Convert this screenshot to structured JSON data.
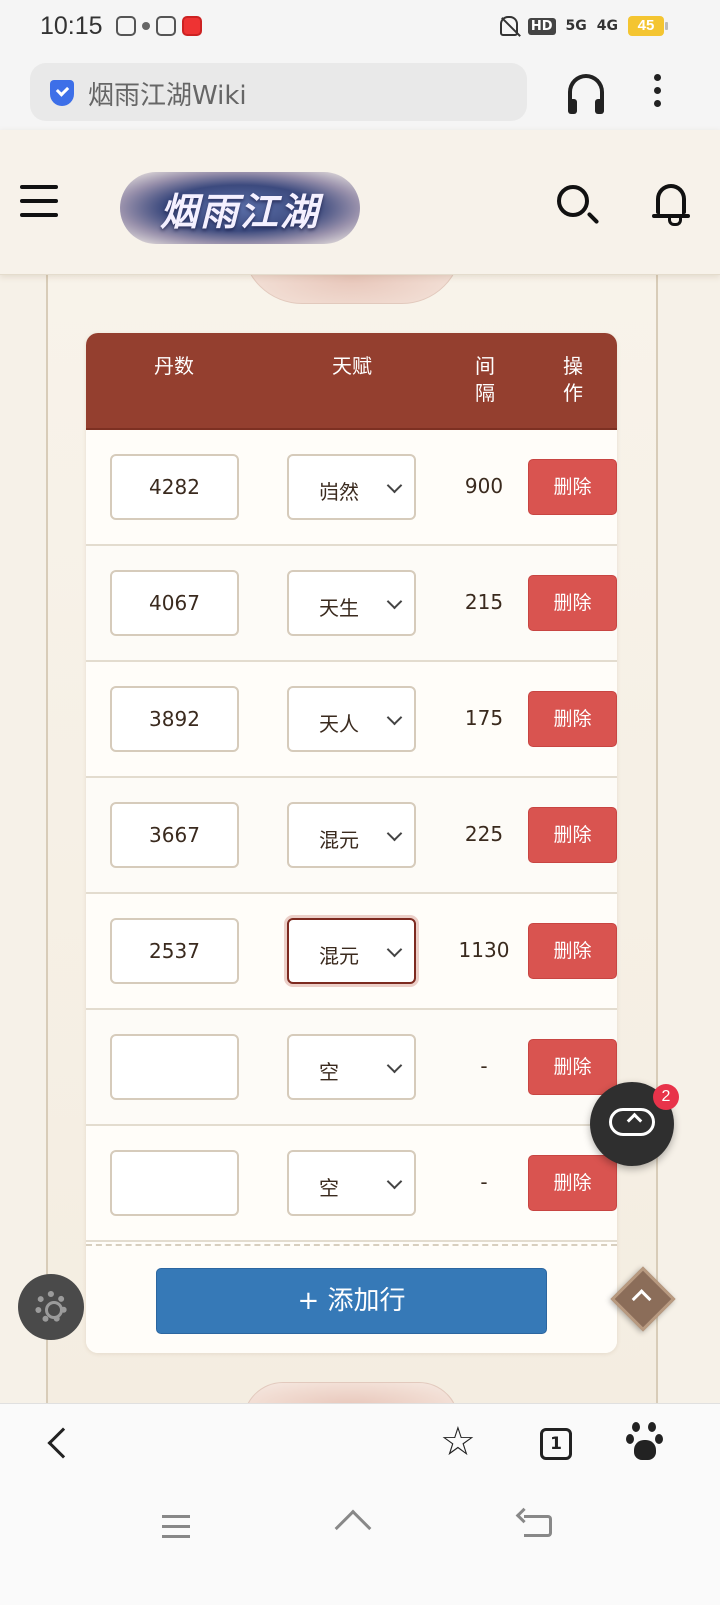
{
  "status_bar": {
    "time": "10:15",
    "hd_label": "HD",
    "signal_5g": "5G",
    "signal_4g": "4G",
    "battery": "45"
  },
  "browser": {
    "url_text": "烟雨江湖Wiki"
  },
  "site": {
    "logo_text": "烟雨江湖"
  },
  "table": {
    "headers": {
      "dan_count": "丹数",
      "talent": "天赋",
      "interval": "间\n隔",
      "action": "操\n作"
    },
    "rows": [
      {
        "dan": "4282",
        "talent": "岿然",
        "interval": "900",
        "delete_label": "删除"
      },
      {
        "dan": "4067",
        "talent": "天生",
        "interval": "215",
        "delete_label": "删除"
      },
      {
        "dan": "3892",
        "talent": "天人",
        "interval": "175",
        "delete_label": "删除"
      },
      {
        "dan": "3667",
        "talent": "混元",
        "interval": "225",
        "delete_label": "删除"
      },
      {
        "dan": "2537",
        "talent": "混元",
        "interval": "1130",
        "delete_label": "删除",
        "focused": true
      },
      {
        "dan": "",
        "talent": "空",
        "interval": "-",
        "delete_label": "删除"
      },
      {
        "dan": "",
        "talent": "空",
        "interval": "-",
        "delete_label": "删除"
      }
    ],
    "add_row_label": "+ 添加行"
  },
  "floating": {
    "upload_badge_count": "2"
  },
  "bottom_toolbar": {
    "tab_count": "1"
  }
}
